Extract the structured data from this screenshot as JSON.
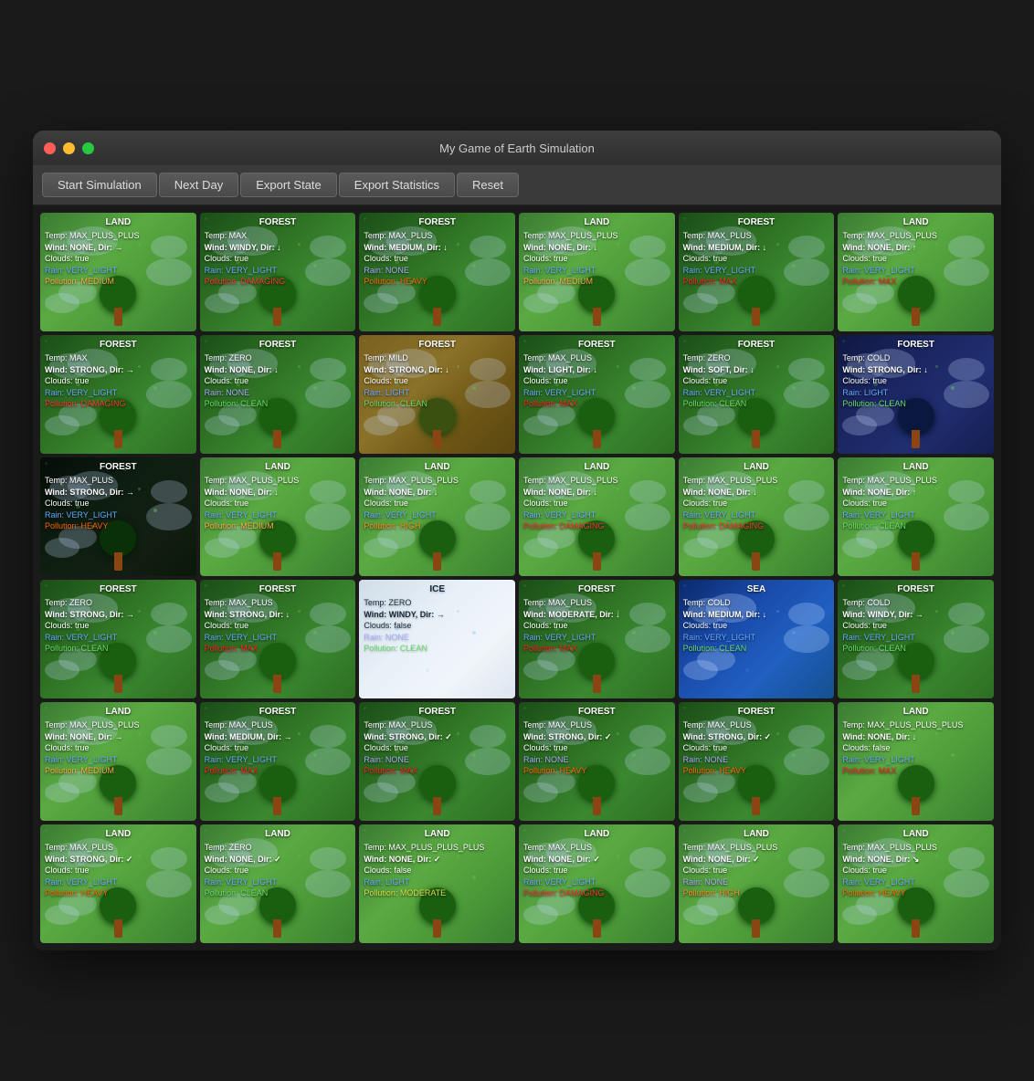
{
  "window": {
    "title": "My Game of Earth Simulation"
  },
  "toolbar": {
    "buttons": [
      {
        "id": "start-sim",
        "label": "Start Simulation"
      },
      {
        "id": "next-day",
        "label": "Next Day"
      },
      {
        "id": "export-state",
        "label": "Export State"
      },
      {
        "id": "export-stats",
        "label": "Export Statistics"
      },
      {
        "id": "reset",
        "label": "Reset"
      }
    ]
  },
  "grid": {
    "cells": [
      {
        "type": "land",
        "name": "LAND",
        "temp": "MAX_PLUS_PLUS",
        "wind_str": "NONE",
        "wind_dir": "→",
        "clouds": true,
        "rain": "VERY_LIGHT",
        "pollution": "MEDIUM",
        "pollution_class": "pollution-orange"
      },
      {
        "type": "forest",
        "name": "FOREST",
        "temp": "MAX",
        "wind_str": "WINDY",
        "wind_dir": "↓",
        "clouds": true,
        "rain": "VERY_LIGHT",
        "pollution": "DAMAGING",
        "pollution_class": "pollution-red"
      },
      {
        "type": "forest",
        "name": "FOREST",
        "temp": "MAX_PLUS",
        "wind_str": "MEDIUM",
        "wind_dir": "↓",
        "clouds": true,
        "rain": "NONE",
        "pollution": "HEAVY",
        "pollution_class": "pollution-dark-orange"
      },
      {
        "type": "land",
        "name": "LAND",
        "temp": "MAX_PLUS_PLUS",
        "wind_str": "NONE",
        "wind_dir": "↓",
        "clouds": true,
        "rain": "VERY_LIGHT",
        "pollution": "MEDIUM",
        "pollution_class": "pollution-orange"
      },
      {
        "type": "forest",
        "name": "FOREST",
        "temp": "MAX_PLUS",
        "wind_str": "MEDIUM",
        "wind_dir": "↓",
        "clouds": true,
        "rain": "VERY_LIGHT",
        "pollution": "MAX",
        "pollution_class": "pollution-red"
      },
      {
        "type": "land",
        "name": "LAND",
        "temp": "MAX_PLUS_PLUS",
        "wind_str": "NONE",
        "wind_dir": "↑",
        "clouds": true,
        "rain": "VERY_LIGHT",
        "pollution": "MAX",
        "pollution_class": "pollution-red"
      },
      {
        "type": "forest",
        "name": "FOREST",
        "temp": "MAX",
        "wind_str": "STRONG",
        "wind_dir": "→",
        "clouds": true,
        "rain": "VERY_LIGHT",
        "pollution": "DAMAGING",
        "pollution_class": "pollution-red"
      },
      {
        "type": "forest",
        "name": "FOREST",
        "temp": "ZERO",
        "wind_str": "NONE",
        "wind_dir": "↓",
        "clouds": true,
        "rain": "NONE",
        "pollution": "CLEAN",
        "pollution_class": "pollution-green"
      },
      {
        "type": "forest-brown",
        "name": "FOREST",
        "temp": "MILD",
        "wind_str": "STRONG",
        "wind_dir": "↓",
        "clouds": true,
        "rain": "LIGHT",
        "pollution": "CLEAN",
        "pollution_class": "pollution-green"
      },
      {
        "type": "forest",
        "name": "FOREST",
        "temp": "MAX_PLUS",
        "wind_str": "LIGHT",
        "wind_dir": "↓",
        "clouds": true,
        "rain": "VERY_LIGHT",
        "pollution": "MAX",
        "pollution_class": "pollution-red"
      },
      {
        "type": "forest",
        "name": "FOREST",
        "temp": "ZERO",
        "wind_str": "SOFT",
        "wind_dir": "↓",
        "clouds": true,
        "rain": "VERY_LIGHT",
        "pollution": "CLEAN",
        "pollution_class": "pollution-green"
      },
      {
        "type": "forest-blue",
        "name": "FOREST",
        "temp": "COLD",
        "wind_str": "STRONG",
        "wind_dir": "↓",
        "clouds": true,
        "rain": "LIGHT",
        "pollution": "CLEAN",
        "pollution_class": "pollution-green"
      },
      {
        "type": "forest-night",
        "name": "FOREST",
        "temp": "MAX_PLUS",
        "wind_str": "STRONG",
        "wind_dir": "→",
        "clouds": true,
        "rain": "VERY_LIGHT",
        "pollution": "HEAVY",
        "pollution_class": "pollution-dark-orange"
      },
      {
        "type": "land",
        "name": "LAND",
        "temp": "MAX_PLUS_PLUS",
        "wind_str": "NONE",
        "wind_dir": "↓",
        "clouds": true,
        "rain": "VERY_LIGHT",
        "pollution": "MEDIUM",
        "pollution_class": "pollution-orange"
      },
      {
        "type": "land",
        "name": "LAND",
        "temp": "MAX_PLUS_PLUS",
        "wind_str": "NONE",
        "wind_dir": "↓",
        "clouds": true,
        "rain": "VERY_LIGHT",
        "pollution": "HIGH",
        "pollution_class": "pollution-dark-orange"
      },
      {
        "type": "land",
        "name": "LAND",
        "temp": "MAX_PLUS_PLUS",
        "wind_str": "NONE",
        "wind_dir": "↓",
        "clouds": true,
        "rain": "VERY_LIGHT",
        "pollution": "DAMAGING",
        "pollution_class": "pollution-red"
      },
      {
        "type": "land",
        "name": "LAND",
        "temp": "MAX_PLUS_PLUS",
        "wind_str": "NONE",
        "wind_dir": "↓",
        "clouds": true,
        "rain": "VERY_LIGHT",
        "pollution": "DAMAGING",
        "pollution_class": "pollution-red"
      },
      {
        "type": "land",
        "name": "LAND",
        "temp": "MAX_PLUS_PLUS",
        "wind_str": "NONE",
        "wind_dir": "↑",
        "clouds": true,
        "rain": "VERY_LIGHT",
        "pollution": "CLEAN",
        "pollution_class": "pollution-green"
      },
      {
        "type": "forest",
        "name": "FOREST",
        "temp": "ZERO",
        "wind_str": "STRONG",
        "wind_dir": "→",
        "clouds": true,
        "rain": "VERY_LIGHT",
        "pollution": "CLEAN",
        "pollution_class": "pollution-green"
      },
      {
        "type": "forest",
        "name": "FOREST",
        "temp": "MAX_PLUS",
        "wind_str": "STRONG",
        "wind_dir": "↓",
        "clouds": true,
        "rain": "VERY_LIGHT",
        "pollution": "MAX",
        "pollution_class": "pollution-red"
      },
      {
        "type": "ice",
        "name": "ICE",
        "temp": "ZERO",
        "wind_str": "WINDY",
        "wind_dir": "→",
        "clouds": false,
        "rain": "NONE",
        "pollution": "CLEAN",
        "pollution_class": "pollution-green"
      },
      {
        "type": "forest",
        "name": "FOREST",
        "temp": "MAX_PLUS",
        "wind_str": "MODERATE",
        "wind_dir": "↓",
        "clouds": true,
        "rain": "VERY_LIGHT",
        "pollution": "MAX",
        "pollution_class": "pollution-red"
      },
      {
        "type": "sea",
        "name": "SEA",
        "temp": "COLD",
        "wind_str": "MEDIUM",
        "wind_dir": "↓",
        "clouds": true,
        "rain": "VERY_LIGHT",
        "pollution": "CLEAN",
        "pollution_class": "pollution-green"
      },
      {
        "type": "forest",
        "name": "FOREST",
        "temp": "COLD",
        "wind_str": "WINDY",
        "wind_dir": "→",
        "clouds": true,
        "rain": "VERY_LIGHT",
        "pollution": "CLEAN",
        "pollution_class": "pollution-green"
      },
      {
        "type": "land",
        "name": "LAND",
        "temp": "MAX_PLUS_PLUS",
        "wind_str": "NONE",
        "wind_dir": "→",
        "clouds": true,
        "rain": "VERY_LIGHT",
        "pollution": "MEDIUM",
        "pollution_class": "pollution-orange"
      },
      {
        "type": "forest",
        "name": "FOREST",
        "temp": "MAX_PLUS",
        "wind_str": "MEDIUM",
        "wind_dir": "→",
        "clouds": true,
        "rain": "VERY_LIGHT",
        "pollution": "MAX",
        "pollution_class": "pollution-red"
      },
      {
        "type": "forest",
        "name": "FOREST",
        "temp": "MAX_PLUS",
        "wind_str": "STRONG",
        "wind_dir": "✓",
        "clouds": true,
        "rain": "NONE",
        "pollution": "MAX",
        "pollution_class": "pollution-red"
      },
      {
        "type": "forest",
        "name": "FOREST",
        "temp": "MAX_PLUS",
        "wind_str": "STRONG",
        "wind_dir": "✓",
        "clouds": true,
        "rain": "NONE",
        "pollution": "HEAVY",
        "pollution_class": "pollution-dark-orange"
      },
      {
        "type": "forest",
        "name": "FOREST",
        "temp": "MAX_PLUS",
        "wind_str": "STRONG",
        "wind_dir": "✓",
        "clouds": true,
        "rain": "NONE",
        "pollution": "HEAVY",
        "pollution_class": "pollution-dark-orange"
      },
      {
        "type": "land",
        "name": "LAND",
        "temp": "MAX_PLUS_PLUS_PLUS",
        "wind_str": "NONE",
        "wind_dir": "↓",
        "clouds": false,
        "rain": "VERY_LIGHT",
        "pollution": "MAX",
        "pollution_class": "pollution-red"
      },
      {
        "type": "land",
        "name": "LAND",
        "temp": "MAX_PLUS",
        "wind_str": "STRONG",
        "wind_dir": "✓",
        "clouds": true,
        "rain": "VERY_LIGHT",
        "pollution": "HEAVY",
        "pollution_class": "pollution-dark-orange"
      },
      {
        "type": "land",
        "name": "LAND",
        "temp": "ZERO",
        "wind_str": "NONE",
        "wind_dir": "✓",
        "clouds": true,
        "rain": "VERY_LIGHT",
        "pollution": "CLEAN",
        "pollution_class": "pollution-green"
      },
      {
        "type": "land",
        "name": "LAND",
        "temp": "MAX_PLUS_PLUS_PLUS",
        "wind_str": "NONE",
        "wind_dir": "✓",
        "clouds": false,
        "rain": "LIGHT",
        "pollution": "MODERATE",
        "pollution_class": "pollution-yellow"
      },
      {
        "type": "land",
        "name": "LAND",
        "temp": "MAX_PLUS",
        "wind_str": "NONE",
        "wind_dir": "✓",
        "clouds": true,
        "rain": "VERY_LIGHT",
        "pollution": "DAMAGING",
        "pollution_class": "pollution-red"
      },
      {
        "type": "land",
        "name": "LAND",
        "temp": "MAX_PLUS_PLUS",
        "wind_str": "NONE",
        "wind_dir": "✓",
        "clouds": true,
        "rain": "NONE",
        "pollution": "HIGH",
        "pollution_class": "pollution-dark-orange"
      },
      {
        "type": "land",
        "name": "LAND",
        "temp": "MAX_PLUS_PLUS",
        "wind_str": "NONE",
        "wind_dir": "↘",
        "clouds": true,
        "rain": "VERY_LIGHT",
        "pollution": "HEAVY",
        "pollution_class": "pollution-dark-orange"
      }
    ]
  }
}
